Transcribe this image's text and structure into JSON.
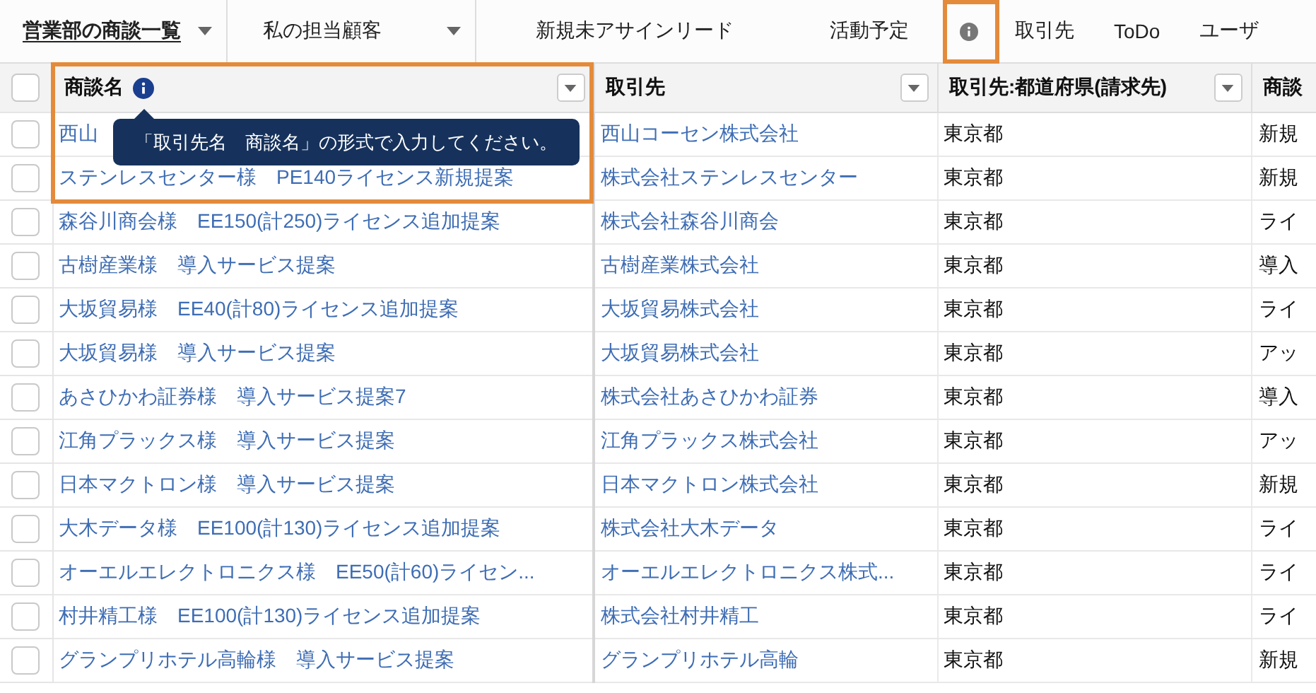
{
  "nav": {
    "tabs": [
      {
        "label": "営業部の商談一覧",
        "selected": true,
        "dropdown": true,
        "info_icon": false
      },
      {
        "label": "私の担当顧客",
        "selected": false,
        "dropdown": true,
        "info_icon": false
      },
      {
        "label": "新規未アサインリード",
        "selected": false,
        "dropdown": false,
        "info_icon": false
      },
      {
        "label": "活動予定",
        "selected": false,
        "dropdown": false,
        "info_icon": true
      },
      {
        "label": "取引先",
        "selected": false,
        "dropdown": false,
        "info_icon": false
      },
      {
        "label": "ToDo",
        "selected": false,
        "dropdown": false,
        "info_icon": false
      },
      {
        "label": "ユーザ",
        "selected": false,
        "dropdown": false,
        "info_icon": false
      }
    ]
  },
  "table": {
    "select_all": {
      "checked": false
    },
    "columns": [
      {
        "label": "商談名",
        "info_icon": true,
        "menu": true,
        "kind": "link"
      },
      {
        "label": "取引先",
        "info_icon": false,
        "menu": true,
        "kind": "link"
      },
      {
        "label": "取引先:都道府県(請求先)",
        "info_icon": false,
        "menu": true,
        "kind": "text"
      },
      {
        "label": "商談",
        "info_icon": false,
        "kind": "text"
      }
    ],
    "rows": [
      {
        "checked": false,
        "cells": [
          "西山",
          "西山コーセン株式会社",
          "東京都",
          "新規"
        ]
      },
      {
        "checked": false,
        "cells": [
          "ステンレスセンター様　PE140ライセンス新規提案",
          "株式会社ステンレスセンター",
          "東京都",
          "新規"
        ]
      },
      {
        "checked": false,
        "cells": [
          "森谷川商会様　EE150(計250)ライセンス追加提案",
          "株式会社森谷川商会",
          "東京都",
          "ライ"
        ]
      },
      {
        "checked": false,
        "cells": [
          "古樹産業様　導入サービス提案",
          "古樹産業株式会社",
          "東京都",
          "導入"
        ]
      },
      {
        "checked": false,
        "cells": [
          "大坂貿易様　EE40(計80)ライセンス追加提案",
          "大坂貿易株式会社",
          "東京都",
          "ライ"
        ]
      },
      {
        "checked": false,
        "cells": [
          "大坂貿易様　導入サービス提案",
          "大坂貿易株式会社",
          "東京都",
          "アッ"
        ]
      },
      {
        "checked": false,
        "cells": [
          "あさひかわ証券様　導入サービス提案7",
          "株式会社あさひかわ証券",
          "東京都",
          "導入"
        ]
      },
      {
        "checked": false,
        "cells": [
          "江角プラックス様　導入サービス提案",
          "江角プラックス株式会社",
          "東京都",
          "アッ"
        ]
      },
      {
        "checked": false,
        "cells": [
          "日本マクトロン様　導入サービス提案",
          "日本マクトロン株式会社",
          "東京都",
          "新規"
        ]
      },
      {
        "checked": false,
        "cells": [
          "大木データ様　EE100(計130)ライセンス追加提案",
          "株式会社大木データ",
          "東京都",
          "ライ"
        ]
      },
      {
        "checked": false,
        "cells": [
          "オーエルエレクトロニクス様　EE50(計60)ライセン...",
          "オーエルエレクトロニクス株式...",
          "東京都",
          "ライ"
        ]
      },
      {
        "checked": false,
        "cells": [
          "村井精工様　EE100(計130)ライセンス追加提案",
          "株式会社村井精工",
          "東京都",
          "ライ"
        ]
      },
      {
        "checked": false,
        "cells": [
          "グランプリホテル高輪様　導入サービス提案",
          "グランプリホテル高輪",
          "東京都",
          "新規"
        ]
      }
    ]
  },
  "tooltip": {
    "text": "「取引先名　商談名」の形式で入力してください。"
  }
}
